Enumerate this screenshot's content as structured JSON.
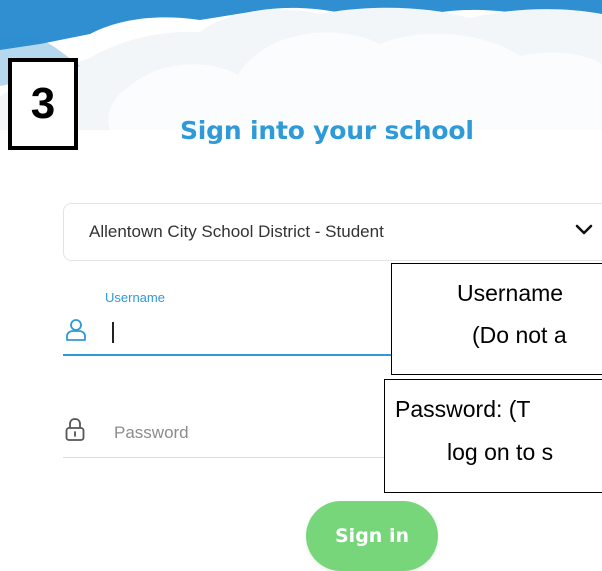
{
  "step": {
    "number": "3"
  },
  "page": {
    "title": "Sign into your school"
  },
  "school_select": {
    "selected": "Allentown City School District - Student"
  },
  "username": {
    "label": "Username",
    "value": ""
  },
  "password": {
    "placeholder": "Password"
  },
  "signin": {
    "label": "Sign in"
  },
  "annotations": {
    "username_line1": "Username",
    "username_line2": "(Do not a",
    "password_line1": "Password: (T",
    "password_line2": "log on to s"
  },
  "colors": {
    "accent": "#2f9ad8",
    "button": "#76d679",
    "sky": "#2f8fd0",
    "cloud": "#f3f6f9"
  },
  "icons": {
    "select": "chevron-down-icon",
    "username": "user-icon",
    "password": "lock-icon"
  }
}
